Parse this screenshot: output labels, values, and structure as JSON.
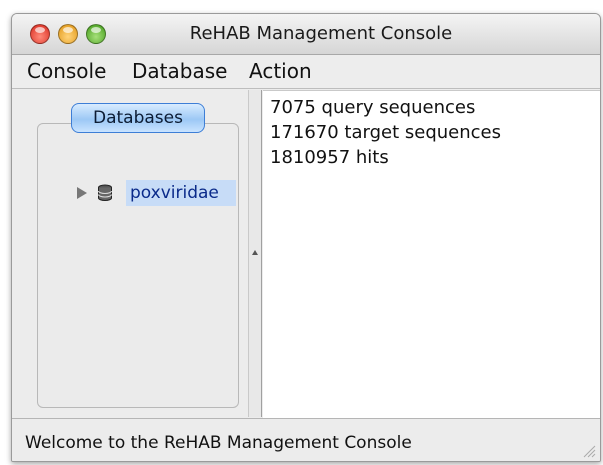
{
  "window": {
    "title": "ReHAB Management Console"
  },
  "menu": {
    "items": [
      "Console",
      "Database",
      "Action"
    ]
  },
  "left_panel": {
    "header": "Databases",
    "tree": [
      {
        "label": "poxviridae",
        "icon": "database-icon",
        "expanded": false,
        "selected": true
      }
    ]
  },
  "info": {
    "lines": [
      "7075 query sequences",
      "171670 target sequences",
      "1810957 hits"
    ]
  },
  "status": {
    "text": "Welcome to the ReHAB Management Console"
  },
  "colors": {
    "selection": "#c7dcf7",
    "header_button": "#9cc8f5",
    "close": "#d8261a",
    "minimize": "#e09410",
    "zoom": "#3f9a16"
  }
}
